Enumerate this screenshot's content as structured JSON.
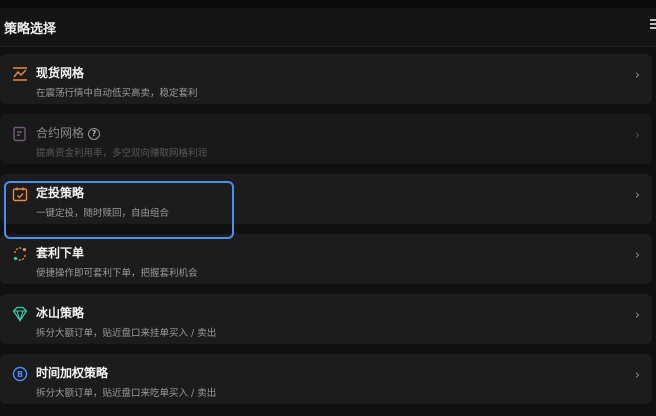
{
  "header": {
    "title": "策略选择",
    "menu_icon": "menu-icon"
  },
  "strategies": [
    {
      "title": "现货网格",
      "desc": "在震荡行情中自动低买高卖，稳定套利",
      "icon": "spot-grid-icon",
      "disabled": false
    },
    {
      "title": "合约网格",
      "desc": "提高资金利用率，多空双向赚取网格利润",
      "icon": "contract-grid-icon",
      "disabled": true
    },
    {
      "title": "定投策略",
      "desc": "一键定投，随时赎回，自由组合",
      "icon": "dca-calendar-icon",
      "disabled": false
    },
    {
      "title": "套利下单",
      "desc": "便捷操作即可套利下单，把握套利机会",
      "icon": "arbitrage-icon",
      "disabled": false
    },
    {
      "title": "冰山策略",
      "desc": "拆分大额订单，贴近盘口来挂单买入 / 卖出",
      "icon": "iceberg-icon",
      "disabled": false
    },
    {
      "title": "时间加权策略",
      "desc": "拆分大额订单，贴近盘口来吃单买入 / 卖出",
      "icon": "twap-icon",
      "disabled": false
    }
  ],
  "colors": {
    "accent_orange": "#e98a3a",
    "highlight_blue": "#4a8ff0",
    "teal": "#3ec7a6"
  }
}
